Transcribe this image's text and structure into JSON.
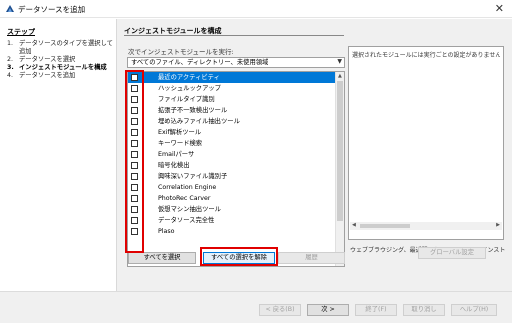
{
  "window": {
    "title": "データソースを追加",
    "close_glyph": "✕"
  },
  "left": {
    "heading": "ステップ",
    "steps": [
      {
        "num": "1.",
        "label": "データソースのタイプを選択して追加"
      },
      {
        "num": "2.",
        "label": "データソースを選択"
      },
      {
        "num": "3.",
        "label": "インジェストモジュールを構成"
      },
      {
        "num": "4.",
        "label": "データソースを追加"
      }
    ]
  },
  "main": {
    "heading": "インジェストモジュールを構成",
    "run_label": "次でインジェストモジュールを実行:",
    "run_select": "すべてのファイル、ディレクトリー、未使用領域",
    "modules": [
      {
        "label": "最近のアクティビティ",
        "checked": false
      },
      {
        "label": "ハッシュルックアップ",
        "checked": false
      },
      {
        "label": "ファイルタイプ識別",
        "checked": false
      },
      {
        "label": "拡張子不一致検出ツール",
        "checked": false
      },
      {
        "label": "埋め込みファイル抽出ツール",
        "checked": false
      },
      {
        "label": "Exif解析ツール",
        "checked": false
      },
      {
        "label": "キーワード検索",
        "checked": false
      },
      {
        "label": "Emailパーサ",
        "checked": false
      },
      {
        "label": "暗号化検出",
        "checked": false
      },
      {
        "label": "興味深いファイル識別子",
        "checked": false
      },
      {
        "label": "Correlation Engine",
        "checked": false
      },
      {
        "label": "PhotoRec Carver",
        "checked": false
      },
      {
        "label": "仮想マシン抽出ツール",
        "checked": false
      },
      {
        "label": "データソース完全性",
        "checked": false
      },
      {
        "label": "Plaso",
        "checked": false
      }
    ],
    "select_all": "すべてを選択",
    "deselect_all": "すべての選択を解除",
    "history": "履歴",
    "right_desc": "選択されたモジュールには実行ごとの設定がありません。",
    "ingest_desc": "ウェブブラウジング、最近開いたドキュメント、インストールされたプログラム",
    "global_settings": "グローバル設定"
  },
  "buttons": {
    "back": "< 戻る(B)",
    "next": "次 >",
    "finish": "終了(F)",
    "cancel": "取り消し",
    "help": "ヘルプ(H)"
  }
}
